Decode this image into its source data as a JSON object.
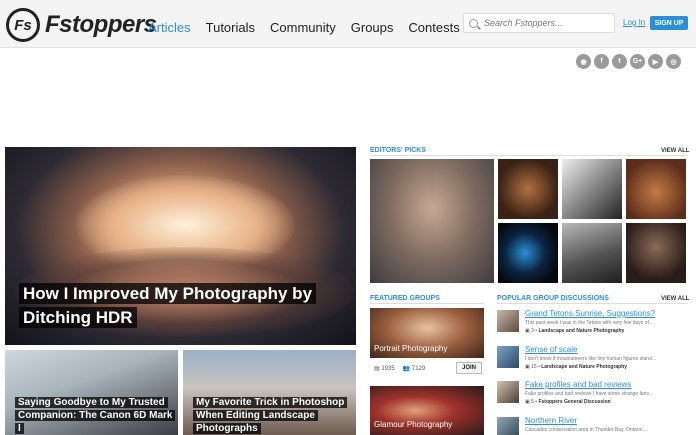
{
  "header": {
    "logo_mark": "Fs",
    "logo_text": "Fstoppers",
    "nav": [
      "Articles",
      "Tutorials",
      "Community",
      "Groups",
      "Contests"
    ],
    "active_nav": "Articles",
    "search_placeholder": "Search Fstoppers...",
    "login_label": "Log In",
    "signup_label": "SIGN UP"
  },
  "social_icons": [
    "rss-icon",
    "facebook-icon",
    "twitter-icon",
    "google-plus-icon",
    "youtube-icon",
    "instagram-icon"
  ],
  "hero": {
    "title": "How I Improved My Photography by Ditching HDR"
  },
  "cards": [
    {
      "title": "Saying Goodbye to My Trusted Companion: The Canon 6D Mark I"
    },
    {
      "title": "My Favorite Trick in Photoshop When Editing Landscape Photographs"
    }
  ],
  "editors_picks": {
    "title": "EDITORS' PICKS",
    "view_all": "VIEW ALL"
  },
  "featured_groups": {
    "title": "FEATURED GROUPS",
    "groups": [
      {
        "name": "Portrait Photography",
        "members": "1935",
        "posts": "7129",
        "join": "JOIN"
      },
      {
        "name": "Glamour Photography"
      }
    ]
  },
  "discussions": {
    "title": "POPULAR GROUP DISCUSSIONS",
    "view_all": "VIEW ALL",
    "items": [
      {
        "title": "Grand Tetons Sunrise, Suggestions?",
        "snippet": "This past week I was in the Tetons with very few days of...",
        "count": "3",
        "group": "Landscape and Nature Photography"
      },
      {
        "title": "Sense of scale",
        "snippet": "I don't know if mountaineers like tiny human figures stand...",
        "count": "15",
        "group": "Landscape and Nature Photography"
      },
      {
        "title": "Fake profiles and bad reviews",
        "snippet": "Fake profiles and bad reviews I have some strange fans...",
        "count": "5",
        "group": "Fstoppers General Discussion"
      },
      {
        "title": "Northern River",
        "snippet": "Cascades conservation area in Thunder Bay, Ontario,..."
      }
    ]
  },
  "colors": {
    "accent": "#2a8fd6",
    "topbar": "#f4f4f4"
  }
}
